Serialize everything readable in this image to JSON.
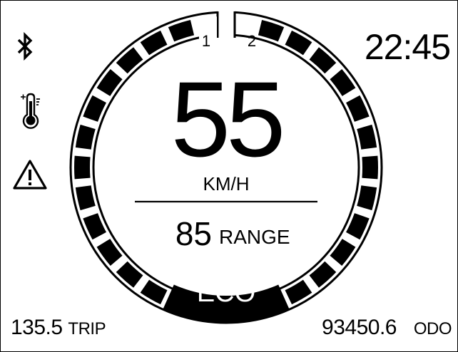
{
  "clock": {
    "time": "22:45"
  },
  "speed": {
    "value": "55",
    "unit": "KM/H"
  },
  "range": {
    "value": "85",
    "label": "RANGE"
  },
  "mode": {
    "label": "ECO"
  },
  "gears": {
    "left": "1",
    "right": "2"
  },
  "trip": {
    "value": "135.5",
    "label": "TRIP"
  },
  "odo": {
    "value": "93450.6",
    "label": "ODO"
  },
  "icons": [
    "bluetooth-icon",
    "temperature-icon",
    "warning-icon"
  ],
  "colors": {
    "foreground": "#000000",
    "background": "#ffffff"
  }
}
